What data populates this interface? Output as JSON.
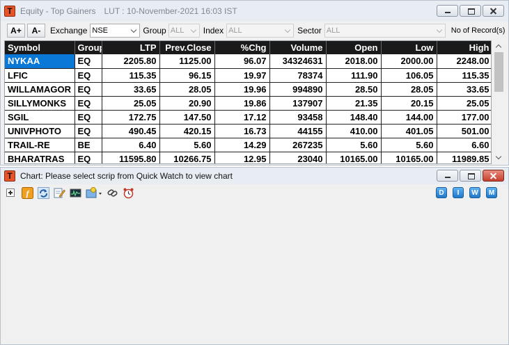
{
  "window1": {
    "title": "Equity - Top Gainers",
    "lut": "LUT : 10-November-2021 16:03 IST",
    "logo_letter": "T"
  },
  "toolbar": {
    "font_increase": "A+",
    "font_decrease": "A-",
    "exchange_label": "Exchange",
    "exchange_value": "NSE",
    "group_label": "Group",
    "group_value": "ALL",
    "index_label": "Index",
    "index_value": "ALL",
    "sector_label": "Sector",
    "sector_value": "ALL",
    "records_label": "No of Record(s)"
  },
  "table": {
    "columns": [
      "Symbol",
      "Group",
      "LTP",
      "Prev.Close",
      "%Chg",
      "Volume",
      "Open",
      "Low",
      "High"
    ],
    "rows": [
      [
        "NYKAA",
        "EQ",
        "2205.80",
        "1125.00",
        "96.07",
        "34324631",
        "2018.00",
        "2000.00",
        "2248.00"
      ],
      [
        "LFIC",
        "EQ",
        "115.35",
        "96.15",
        "19.97",
        "78374",
        "111.90",
        "106.05",
        "115.35"
      ],
      [
        "WILLAMAGOR",
        "EQ",
        "33.65",
        "28.05",
        "19.96",
        "994890",
        "28.50",
        "28.05",
        "33.65"
      ],
      [
        "SILLYMONKS",
        "EQ",
        "25.05",
        "20.90",
        "19.86",
        "137907",
        "21.35",
        "20.15",
        "25.05"
      ],
      [
        "SGIL",
        "EQ",
        "172.75",
        "147.50",
        "17.12",
        "93458",
        "148.40",
        "144.00",
        "177.00"
      ],
      [
        "UNIVPHOTO",
        "EQ",
        "490.45",
        "420.15",
        "16.73",
        "44155",
        "410.00",
        "401.05",
        "501.00"
      ],
      [
        "TRAIL-RE",
        "BE",
        "6.40",
        "5.60",
        "14.29",
        "267235",
        "5.60",
        "5.60",
        "6.60"
      ],
      [
        "BHARATRAS",
        "EQ",
        "11595.80",
        "10266.75",
        "12.95",
        "23040",
        "10165.00",
        "10165.00",
        "11989.85"
      ]
    ],
    "selected_symbol": "NYKAA"
  },
  "window2": {
    "title": "Chart: Please select scrip from Quick Watch to view chart",
    "logo_letter": "T",
    "period_buttons": [
      "D",
      "I",
      "W",
      "M"
    ]
  },
  "icons": {
    "expand": "plus-box-icon",
    "formula": "function-icon",
    "refresh": "refresh-arrow-icon",
    "edit": "pencil-note-icon",
    "indicator": "oscilloscope-icon",
    "studies": "chart-wizard-icon",
    "link": "chain-link-icon",
    "alarm": "alarm-clock-icon"
  },
  "colors": {
    "header_bg": "#1a1a1a",
    "selected_bg": "#0a78d7",
    "logo": "#e8542a",
    "period_button": "#1f77c9"
  }
}
